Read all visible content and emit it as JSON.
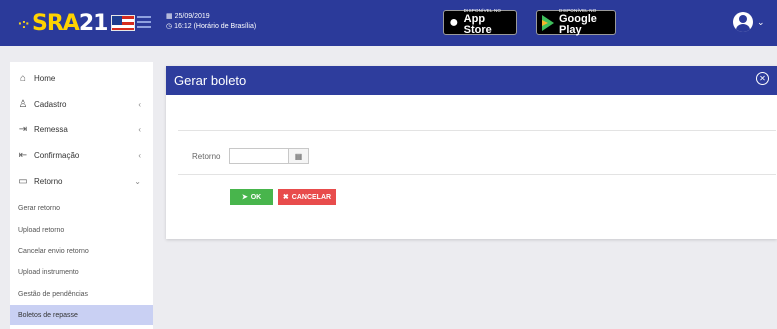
{
  "header": {
    "logo_dots": "·:·",
    "logo_text_prefix": "SRA",
    "logo_text_number": "21",
    "date": "25/09/2019",
    "time": "16:12 (Horário de Brasília)",
    "appstore_small": "DISPONÍVEL NO",
    "appstore_big": "App Store",
    "googleplay_small": "DISPONÍVEL NO",
    "googleplay_big": "Google Play"
  },
  "sidebar": {
    "items": [
      {
        "label": "Home"
      },
      {
        "label": "Cadastro"
      },
      {
        "label": "Remessa"
      },
      {
        "label": "Confirmação"
      },
      {
        "label": "Retorno"
      }
    ],
    "sub_items": [
      {
        "label": "Gerar retorno"
      },
      {
        "label": "Upload retorno"
      },
      {
        "label": "Cancelar envio retorno"
      },
      {
        "label": "Upload instrumento"
      },
      {
        "label": "Gestão de pendências"
      },
      {
        "label": "Boletos de repasse"
      }
    ],
    "active_sub_item": "Boletos de repasse"
  },
  "card": {
    "title": "Gerar boleto",
    "field_label": "Retorno",
    "field_value": "",
    "ok_label": "OK",
    "cancel_label": "CANCELAR"
  },
  "colors": {
    "primary": "#2b3a9a",
    "ok": "#48b54c",
    "cancel": "#e84c4c",
    "active_sub": "#c9d0f3"
  }
}
